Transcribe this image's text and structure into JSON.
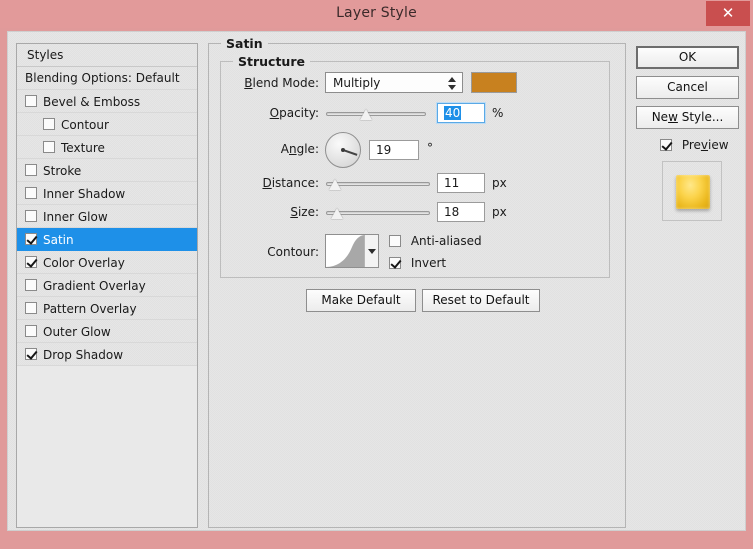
{
  "window": {
    "title": "Layer Style",
    "close_label": "✕",
    "titlebar_color": "#e29a9a",
    "close_color": "#c94f4f"
  },
  "styles_panel": {
    "header": "Styles",
    "blending_options": "Blending Options: Default",
    "items": [
      {
        "label": "Bevel & Emboss",
        "checked": false,
        "indent": false,
        "selected": false
      },
      {
        "label": "Contour",
        "checked": false,
        "indent": true,
        "selected": false
      },
      {
        "label": "Texture",
        "checked": false,
        "indent": true,
        "selected": false
      },
      {
        "label": "Stroke",
        "checked": false,
        "indent": false,
        "selected": false
      },
      {
        "label": "Inner Shadow",
        "checked": false,
        "indent": false,
        "selected": false
      },
      {
        "label": "Inner Glow",
        "checked": false,
        "indent": false,
        "selected": false
      },
      {
        "label": "Satin",
        "checked": true,
        "indent": false,
        "selected": true
      },
      {
        "label": "Color Overlay",
        "checked": true,
        "indent": false,
        "selected": false
      },
      {
        "label": "Gradient Overlay",
        "checked": false,
        "indent": false,
        "selected": false
      },
      {
        "label": "Pattern Overlay",
        "checked": false,
        "indent": false,
        "selected": false
      },
      {
        "label": "Outer Glow",
        "checked": false,
        "indent": false,
        "selected": false
      },
      {
        "label": "Drop Shadow",
        "checked": true,
        "indent": false,
        "selected": false
      }
    ],
    "selection_color": "#1e90e8"
  },
  "satin": {
    "group_title": "Satin",
    "structure_title": "Structure",
    "blend_mode": {
      "label": "Blend Mode:",
      "value": "Multiply",
      "color_swatch": "#c8811f"
    },
    "opacity": {
      "label": "Opacity:",
      "value": "40",
      "unit": "%",
      "slider_percent": 40,
      "focused": true,
      "selected": true
    },
    "angle": {
      "label": "Angle:",
      "value": "19",
      "unit": "°",
      "degrees": 19
    },
    "distance": {
      "label": "Distance:",
      "value": "11",
      "unit": "px",
      "slider_percent": 9
    },
    "size": {
      "label": "Size:",
      "value": "18",
      "unit": "px",
      "slider_percent": 11
    },
    "contour": {
      "label": "Contour:",
      "anti_aliased": {
        "label": "Anti-aliased",
        "checked": false
      },
      "invert": {
        "label": "Invert",
        "checked": true
      }
    },
    "make_default": "Make Default",
    "reset_to_default": "Reset to Default"
  },
  "actions": {
    "ok": "OK",
    "cancel": "Cancel",
    "new_style": "New Style...",
    "preview": {
      "label": "Preview",
      "checked": true
    }
  }
}
